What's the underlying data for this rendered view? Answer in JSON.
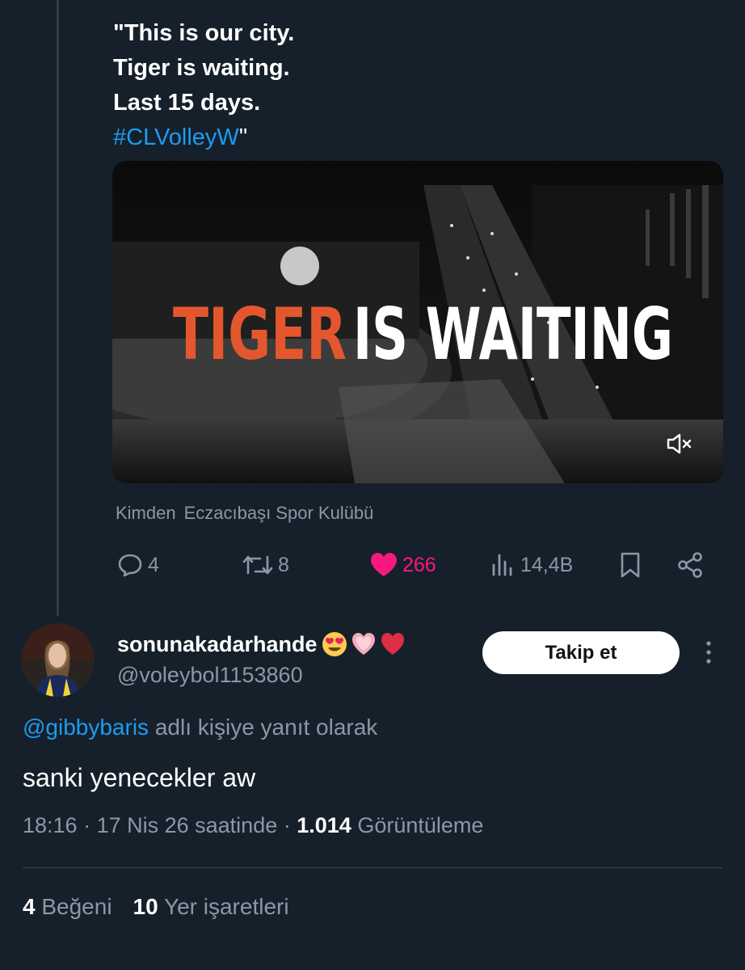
{
  "quote": {
    "lines": [
      "\"This is our city.",
      "Tiger is waiting.",
      "Last 15 days."
    ],
    "hashtag": "#CLVolleyW",
    "hashtag_suffix": "\""
  },
  "media": {
    "headline_word1": "TIGER",
    "headline_word2": "IS WAITING",
    "word1_color": "#e4572e",
    "word2_color": "#ffffff",
    "muted": true
  },
  "source": {
    "prefix": "Kimden",
    "name": "Eczacıbaşı Spor Kulübü"
  },
  "actions": {
    "replies": "4",
    "retweets": "8",
    "likes": "266",
    "views": "14,4B",
    "like_color": "#f91880"
  },
  "reply": {
    "display_name": "sonunakadarhande",
    "name_emojis": [
      "heart-eyes-emoji",
      "pink-heart-emoji",
      "red-heart-emoji"
    ],
    "handle": "@voleybol1153860",
    "follow_label": "Takip et",
    "reply_to_mention": "@gibbybaris",
    "reply_to_suffix": "adlı kişiye yanıt olarak",
    "text": "sanki yenecekler aw",
    "time": "18:16",
    "date": "17 Nis 26 saatinde",
    "views_count": "1.014",
    "views_label": "Görüntüleme",
    "likes_count": "4",
    "likes_label": "Beğeni",
    "bookmarks_count": "10",
    "bookmarks_label": "Yer işaretleri"
  },
  "colors": {
    "background": "#15202b",
    "link": "#1d9bf0",
    "muted_text": "#8b98a5"
  }
}
